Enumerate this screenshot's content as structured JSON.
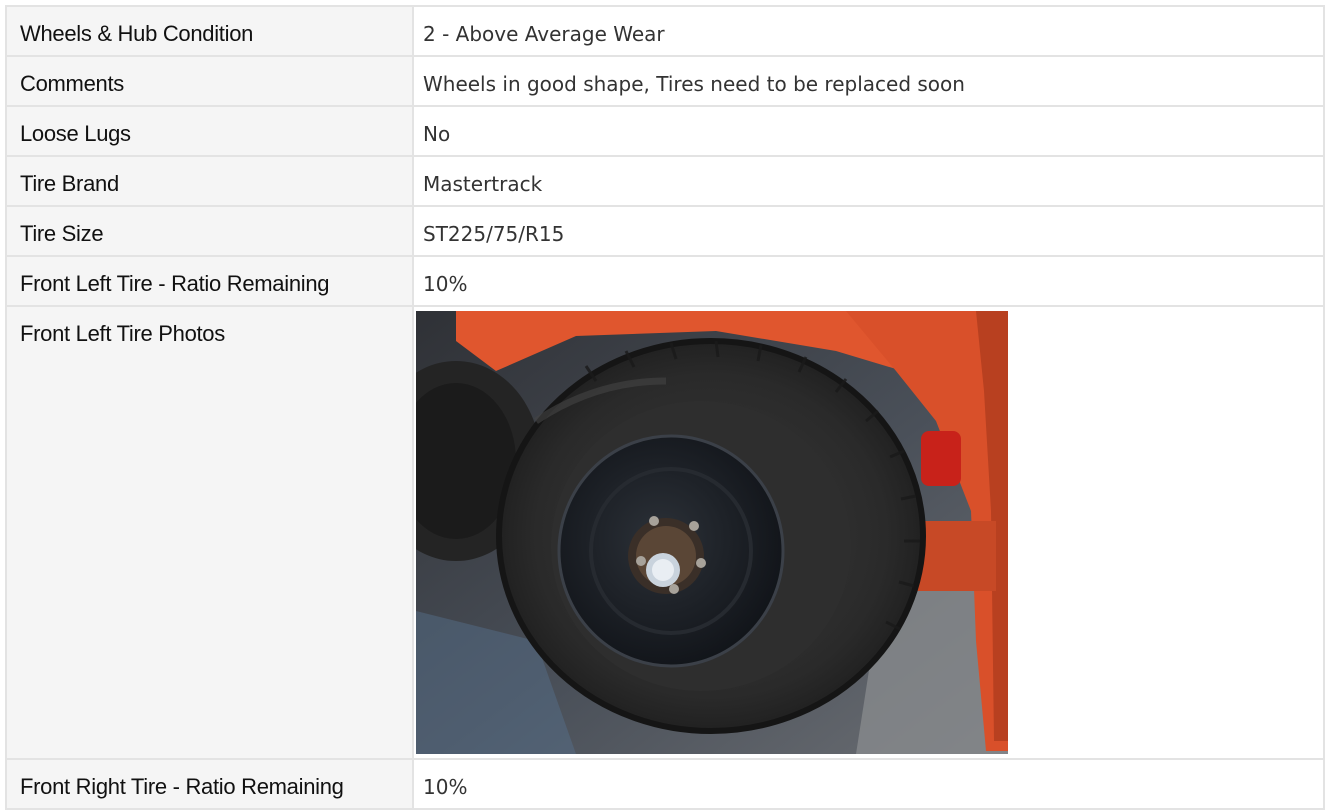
{
  "rows": [
    {
      "label": "Wheels & Hub Condition",
      "value": "2 - Above Average Wear"
    },
    {
      "label": "Comments",
      "value": "Wheels in good shape, Tires need to be replaced soon"
    },
    {
      "label": "Loose Lugs",
      "value": "No"
    },
    {
      "label": "Tire Brand",
      "value": "Mastertrack"
    },
    {
      "label": "Tire Size",
      "value": "ST225/75/R15"
    },
    {
      "label": "Front Left Tire - Ratio Remaining",
      "value": "10%"
    },
    {
      "label": "Front Left Tire Photos",
      "value": ""
    },
    {
      "label": "Front Right Tire - Ratio Remaining",
      "value": "10%"
    }
  ],
  "photo": {
    "icon": "trailer-tire-photo",
    "colors": {
      "trailer": "#e0562e",
      "tire": "#2b2b2b",
      "asphalt": "#3f434a",
      "rim": "#1a1d22"
    }
  }
}
